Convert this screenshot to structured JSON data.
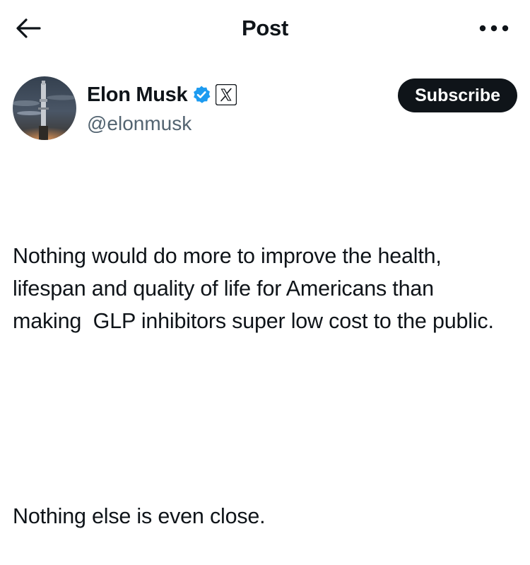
{
  "header": {
    "title": "Post",
    "back_icon": "arrow-left-icon",
    "more_icon": "more-horizontal-icon"
  },
  "author": {
    "display_name": "Elon Musk",
    "handle": "@elonmusk",
    "verified_badge_icon": "verified-badge-icon",
    "affiliate_icon": "x-logo-icon",
    "verified_color": "#1d9bf0"
  },
  "actions": {
    "subscribe_label": "Subscribe"
  },
  "post": {
    "paragraph_1": "Nothing would do more to improve the health, lifespan and quality of life for Americans than making  GLP inhibitors super low cost to the public.",
    "paragraph_2": "Nothing else is even close."
  },
  "colors": {
    "text": "#0f1419",
    "secondary_text": "#536471",
    "button_bg": "#0f1419",
    "button_text": "#ffffff"
  }
}
